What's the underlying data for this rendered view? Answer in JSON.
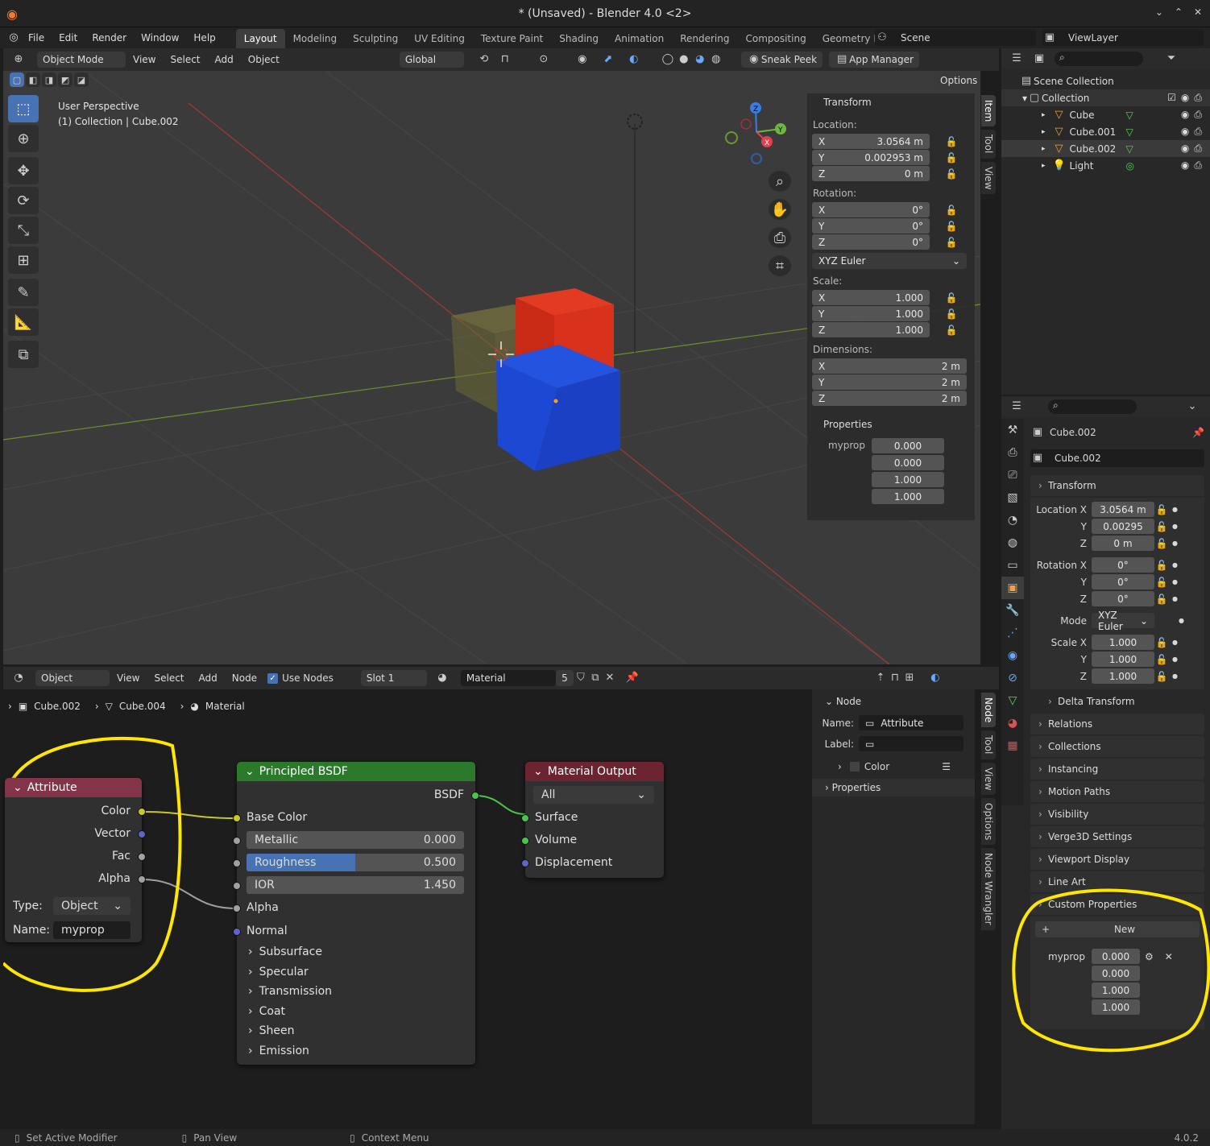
{
  "window": {
    "title": "* (Unsaved) - Blender 4.0 <2>"
  },
  "menu": [
    "File",
    "Edit",
    "Render",
    "Window",
    "Help"
  ],
  "workspaces": [
    "Layout",
    "Modeling",
    "Sculpting",
    "UV Editing",
    "Texture Paint",
    "Shading",
    "Animation",
    "Rendering",
    "Compositing",
    "Geometry Nodes"
  ],
  "scene": "Scene",
  "viewlayer": "ViewLayer",
  "viewport_header": {
    "mode": "Object Mode",
    "menus": [
      "View",
      "Select",
      "Add",
      "Object"
    ],
    "transform": "Global",
    "sneak": "Sneak Peek",
    "appmgr": "App Manager",
    "options": "Options"
  },
  "viewport": {
    "perspective": "User Perspective",
    "context": "(1) Collection | Cube.002",
    "axes": {
      "z": "Z",
      "y": "Y",
      "x": "X"
    }
  },
  "npanel": {
    "transform_label": "Transform",
    "location_label": "Location:",
    "rotation_label": "Rotation:",
    "scale_label": "Scale:",
    "dimensions_label": "Dimensions:",
    "location": [
      {
        "a": "X",
        "v": "3.0564 m"
      },
      {
        "a": "Y",
        "v": "0.002953 m"
      },
      {
        "a": "Z",
        "v": "0 m"
      }
    ],
    "rotation": [
      {
        "a": "X",
        "v": "0°"
      },
      {
        "a": "Y",
        "v": "0°"
      },
      {
        "a": "Z",
        "v": "0°"
      }
    ],
    "rotation_mode": "XYZ Euler",
    "scale": [
      {
        "a": "X",
        "v": "1.000"
      },
      {
        "a": "Y",
        "v": "1.000"
      },
      {
        "a": "Z",
        "v": "1.000"
      }
    ],
    "dimensions": [
      {
        "a": "X",
        "v": "2 m"
      },
      {
        "a": "Y",
        "v": "2 m"
      },
      {
        "a": "Z",
        "v": "2 m"
      }
    ],
    "properties_label": "Properties",
    "myprop_label": "myprop",
    "myprop": [
      "0.000",
      "0.000",
      "1.000",
      "1.000"
    ],
    "tabs": [
      "Item",
      "Tool",
      "View"
    ]
  },
  "outliner": {
    "scene_collection": "Scene Collection",
    "collection": "Collection",
    "items": [
      "Cube",
      "Cube.001",
      "Cube.002",
      "Light"
    ]
  },
  "properties": {
    "object_name": "Cube.002",
    "data_name": "Cube.002",
    "transform_label": "Transform",
    "location_x_label": "Location X",
    "rotation_x_label": "Rotation X",
    "scale_x_label": "Scale X",
    "y": "Y",
    "z": "Z",
    "mode_label": "Mode",
    "location": [
      "3.0564 m",
      "0.00295",
      "0 m"
    ],
    "rotation": [
      "0°",
      "0°",
      "0°"
    ],
    "mode": "XYZ Euler",
    "scale": [
      "1.000",
      "1.000",
      "1.000"
    ],
    "delta": "Delta Transform",
    "sections": [
      "Relations",
      "Collections",
      "Instancing",
      "Motion Paths",
      "Visibility",
      "Verge3D Settings",
      "Viewport Display",
      "Line Art"
    ],
    "custom": "Custom Properties",
    "new": "New",
    "myprop": "myprop",
    "values": [
      "0.000",
      "0.000",
      "1.000",
      "1.000"
    ]
  },
  "node_header": {
    "editor": "Object",
    "menus": [
      "View",
      "Select",
      "Add",
      "Node"
    ],
    "use_nodes": "Use Nodes",
    "slot": "Slot 1",
    "material": "Material",
    "users": "5"
  },
  "breadcrumb": [
    "Cube.002",
    "Cube.004",
    "Material"
  ],
  "nodes": {
    "attribute": {
      "title": "Attribute",
      "outputs": [
        "Color",
        "Vector",
        "Fac",
        "Alpha"
      ],
      "type_label": "Type:",
      "type": "Object",
      "name_label": "Name:",
      "name": "myprop"
    },
    "bsdf": {
      "title": "Principled BSDF",
      "out": "BSDF",
      "base": "Base Color",
      "metallic": "Metallic",
      "metallic_v": "0.000",
      "roughness": "Roughness",
      "roughness_v": "0.500",
      "roughness_fill": 0.5,
      "ior": "IOR",
      "ior_v": "1.450",
      "alpha": "Alpha",
      "normal": "Normal",
      "panels": [
        "Subsurface",
        "Specular",
        "Transmission",
        "Coat",
        "Sheen",
        "Emission"
      ]
    },
    "output": {
      "title": "Material Output",
      "target": "All",
      "inputs": [
        "Surface",
        "Volume",
        "Displacement"
      ]
    }
  },
  "node_side": {
    "node_label": "Node",
    "name_label": "Name:",
    "name": "Attribute",
    "label_label": "Label:",
    "color": "Color",
    "properties": "Properties",
    "tabs": [
      "Node",
      "Tool",
      "View",
      "Options",
      "Node Wrangler"
    ]
  },
  "status": {
    "a": "Set Active Modifier",
    "b": "Pan View",
    "c": "Context Menu",
    "version": "4.0.2"
  }
}
